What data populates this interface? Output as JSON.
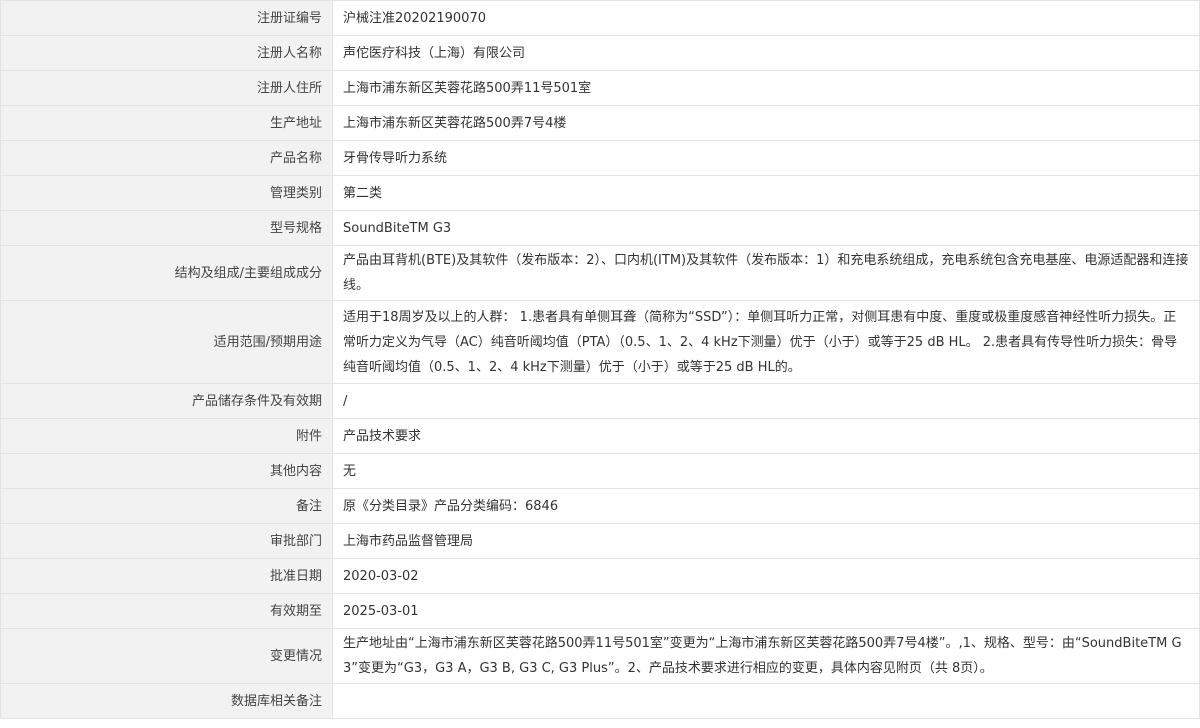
{
  "rows": [
    {
      "label": "注册证编号",
      "value": "沪械注准20202190070"
    },
    {
      "label": "注册人名称",
      "value": "声佗医疗科技（上海）有限公司"
    },
    {
      "label": "注册人住所",
      "value": "上海市浦东新区芙蓉花路500弄11号501室"
    },
    {
      "label": "生产地址",
      "value": "上海市浦东新区芙蓉花路500弄7号4楼"
    },
    {
      "label": "产品名称",
      "value": "牙骨传导听力系统"
    },
    {
      "label": "管理类别",
      "value": "第二类"
    },
    {
      "label": "型号规格",
      "value": "SoundBiteTM G3"
    },
    {
      "label": "结构及组成/主要组成成分",
      "value": "产品由耳背机(BTE)及其软件（发布版本：2）、口内机(ITM)及其软件（发布版本：1）和充电系统组成，充电系统包含充电基座、电源适配器和连接线。"
    },
    {
      "label": "适用范围/预期用途",
      "value": "适用于18周岁及以上的人群： 1.患者具有单侧耳聋（简称为“SSD”）：单侧耳听力正常，对侧耳患有中度、重度或极重度感音神经性听力损失。正常听力定义为气导（AC）纯音听阈均值（PTA）（0.5、1、2、4 kHz下测量）优于（小于）或等于25 dB HL。 2.患者具有传导性听力损失：骨导纯音听阈均值（0.5、1、2、4 kHz下测量）优于（小于）或等于25 dB HL的。"
    },
    {
      "label": "产品储存条件及有效期",
      "value": "/"
    },
    {
      "label": "附件",
      "value": "产品技术要求"
    },
    {
      "label": "其他内容",
      "value": "无"
    },
    {
      "label": "备注",
      "value": "原《分类目录》产品分类编码：6846"
    },
    {
      "label": "审批部门",
      "value": "上海市药品监督管理局"
    },
    {
      "label": "批准日期",
      "value": "2020-03-02"
    },
    {
      "label": "有效期至",
      "value": "2025-03-01"
    },
    {
      "label": "变更情况",
      "value": "生产地址由“上海市浦东新区芙蓉花路500弄11号501室”变更为“上海市浦东新区芙蓉花路500弄7号4楼”。,1、规格、型号：由“SoundBiteTM G3”变更为“G3，G3 A，G3 B, G3 C, G3 Plus”。2、产品技术要求进行相应的变更，具体内容见附页（共 8页）。"
    },
    {
      "label": "数据库相关备注",
      "value": ""
    }
  ]
}
